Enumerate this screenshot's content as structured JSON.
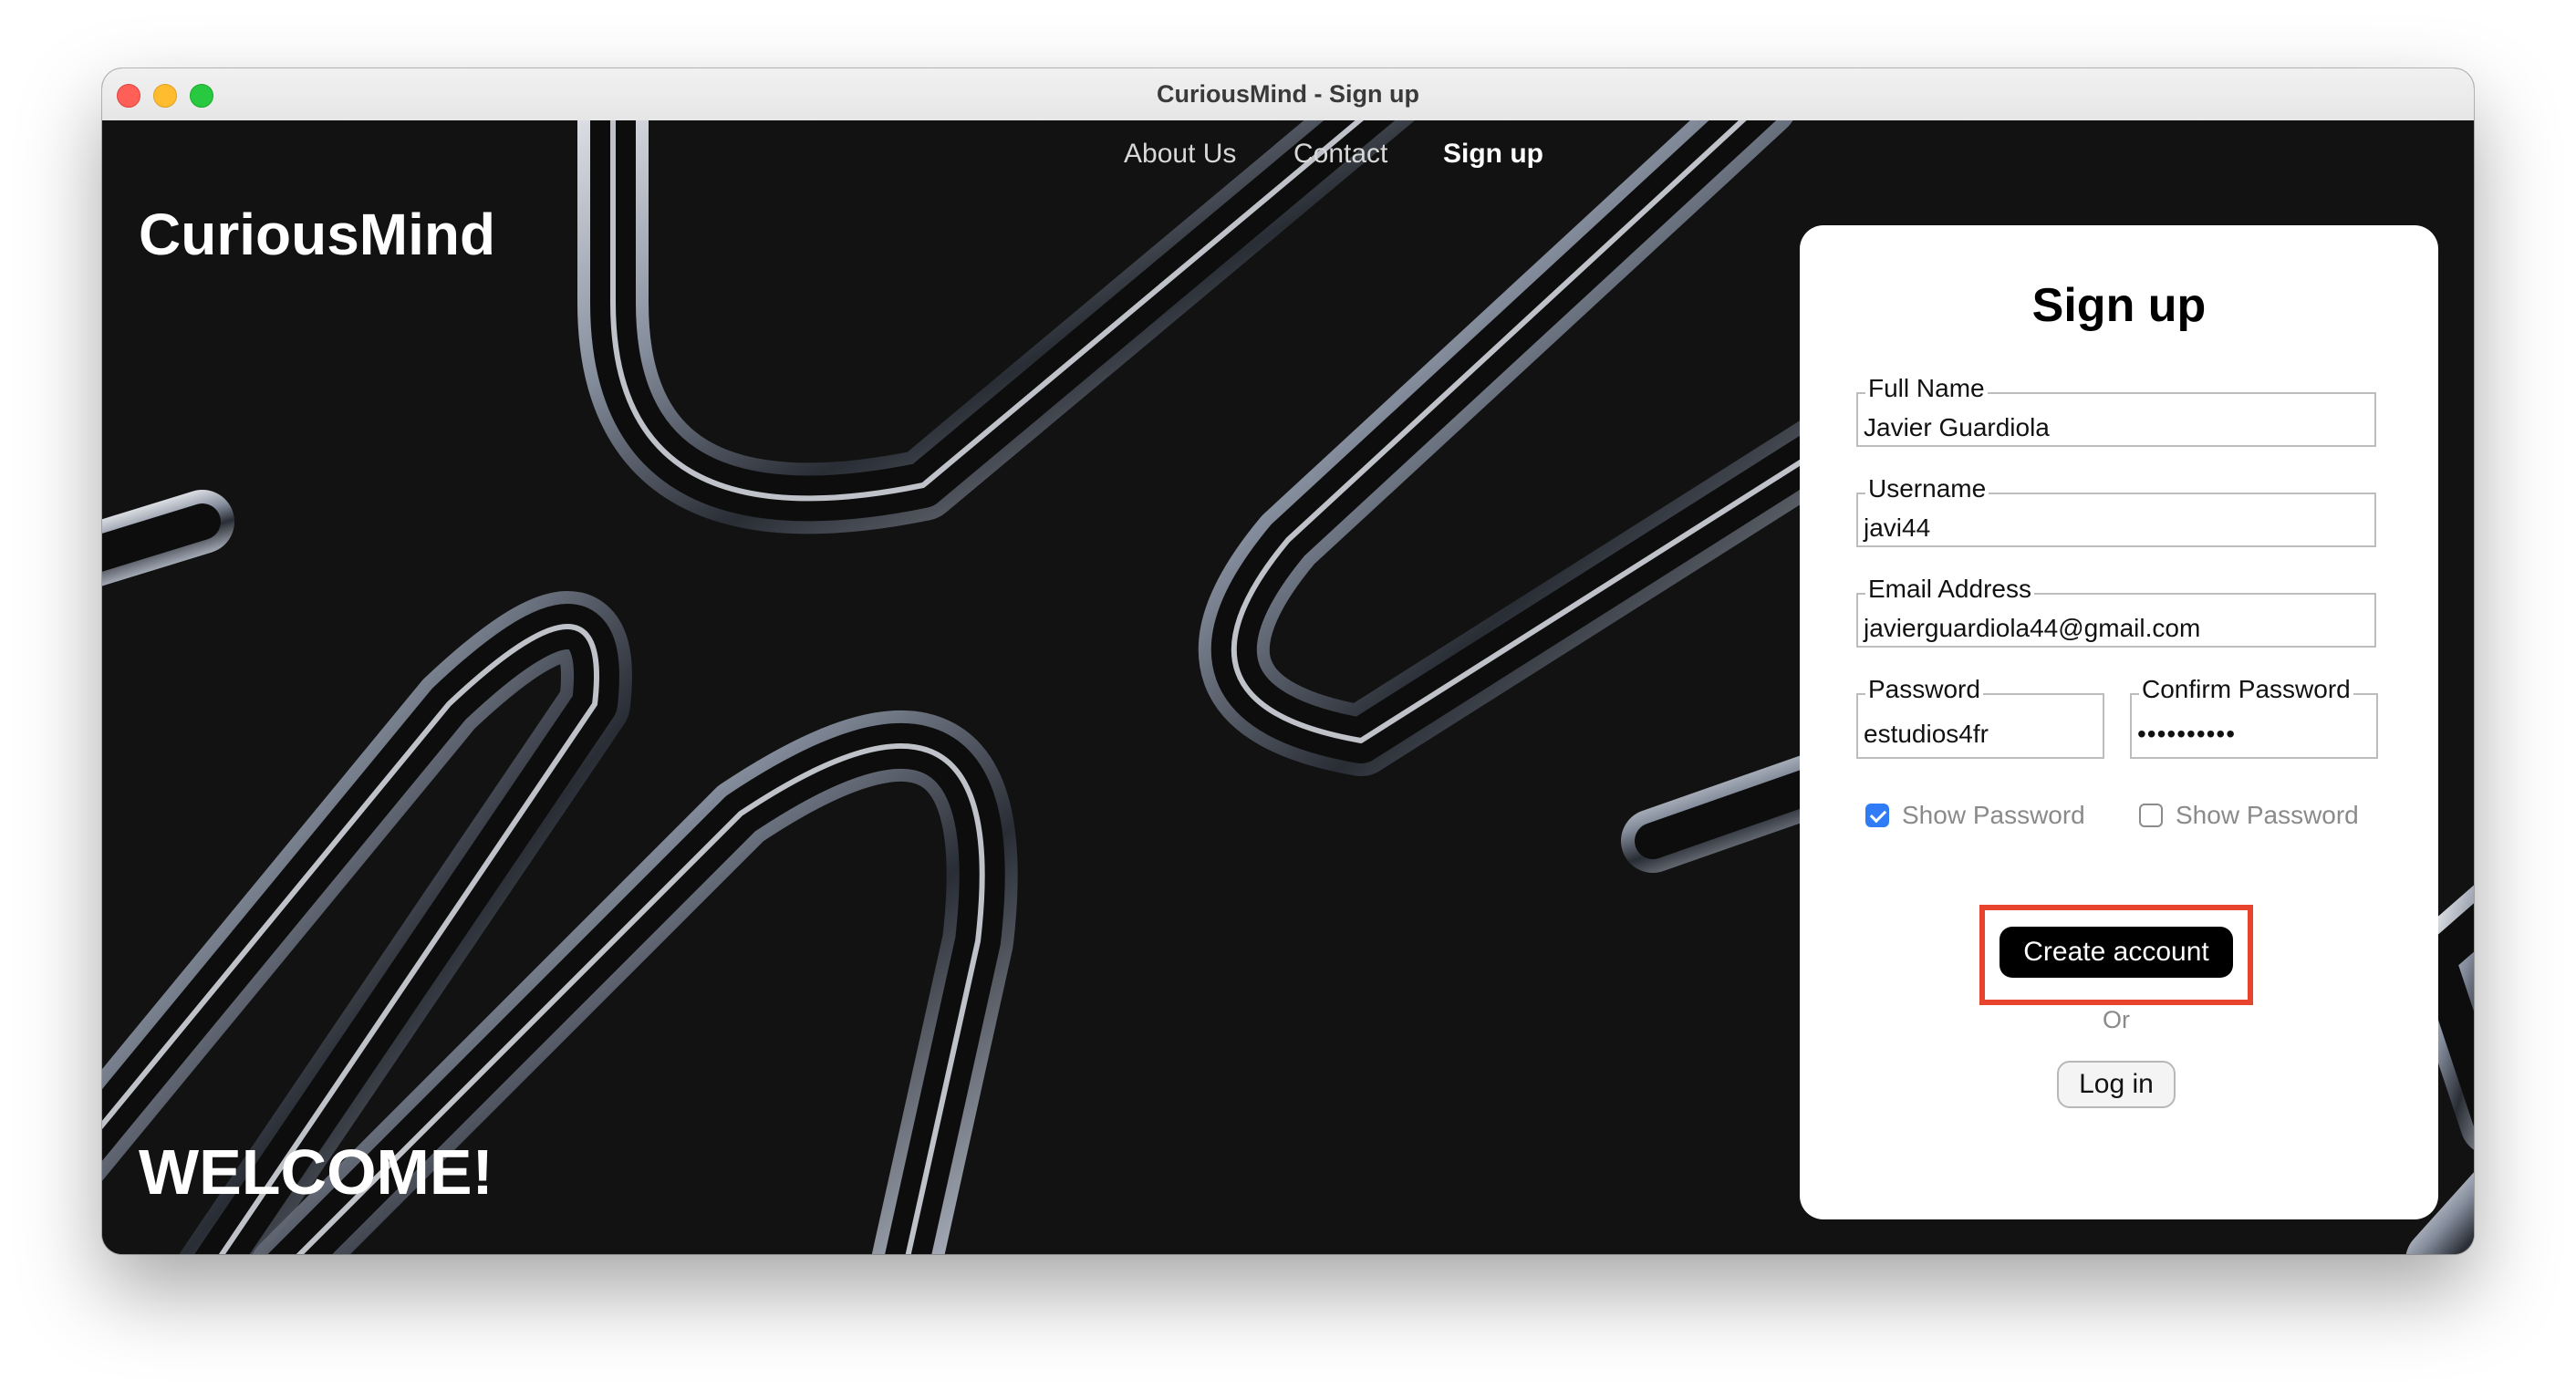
{
  "window": {
    "title": "CuriousMind - Sign up"
  },
  "nav": {
    "about_label": "About Us",
    "contact_label": "Contact",
    "signup_label": "Sign up"
  },
  "brand": "CuriousMind",
  "welcome": "WELCOME!",
  "signup_form": {
    "title": "Sign up",
    "full_name": {
      "label": "Full Name",
      "value": "Javier Guardiola"
    },
    "username": {
      "label": "Username",
      "value": "javi44"
    },
    "email": {
      "label": "Email Address",
      "value": "javierguardiola44@gmail.com"
    },
    "password": {
      "label": "Password",
      "value": "estudios4fr"
    },
    "confirm_password": {
      "label": "Confirm Password",
      "value": "••••••••••"
    },
    "show_password_1": {
      "label": "Show Password",
      "checked": true
    },
    "show_password_2": {
      "label": "Show Password",
      "checked": false
    },
    "create_button": "Create account",
    "or_text": "Or",
    "login_button": "Log in"
  },
  "colors": {
    "background": "#121212",
    "card": "#ffffff",
    "checkbox_on": "#2f7cf6",
    "highlight": "#e8432d",
    "primary_button": "#000000"
  }
}
